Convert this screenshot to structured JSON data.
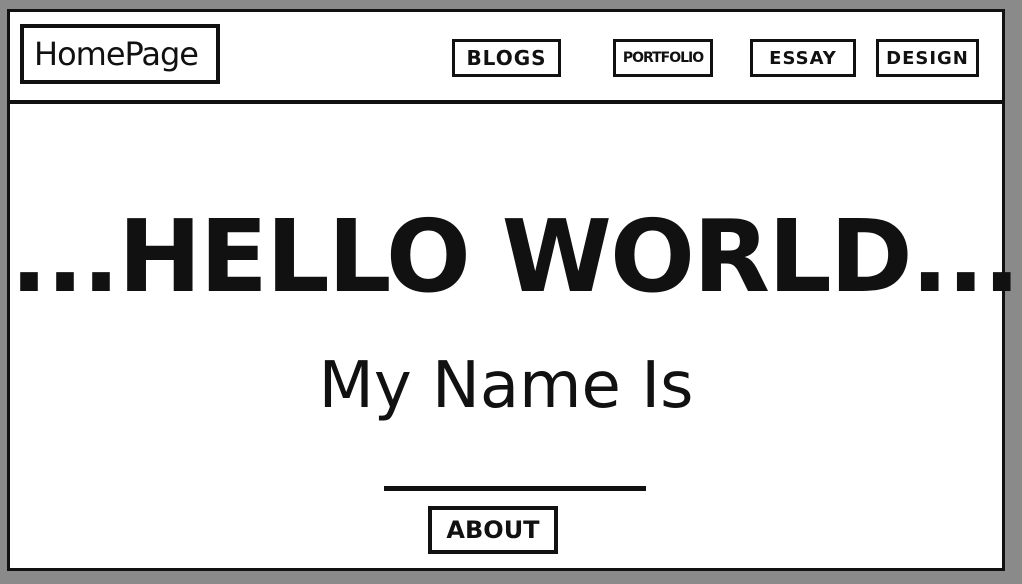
{
  "header": {
    "logo_text": "HomePage",
    "nav": [
      {
        "label": "BLOGS"
      },
      {
        "label": "PORTFOLIO"
      },
      {
        "label": "ESSAY"
      },
      {
        "label": "DESIGN"
      }
    ]
  },
  "hero": {
    "headline": "...HELLO WORLD...",
    "subtitle": "My Name Is"
  },
  "about_button": {
    "label": "ABOUT"
  },
  "colors": {
    "background": "#8a8a8a",
    "page": "#ffffff",
    "ink": "#111111"
  }
}
